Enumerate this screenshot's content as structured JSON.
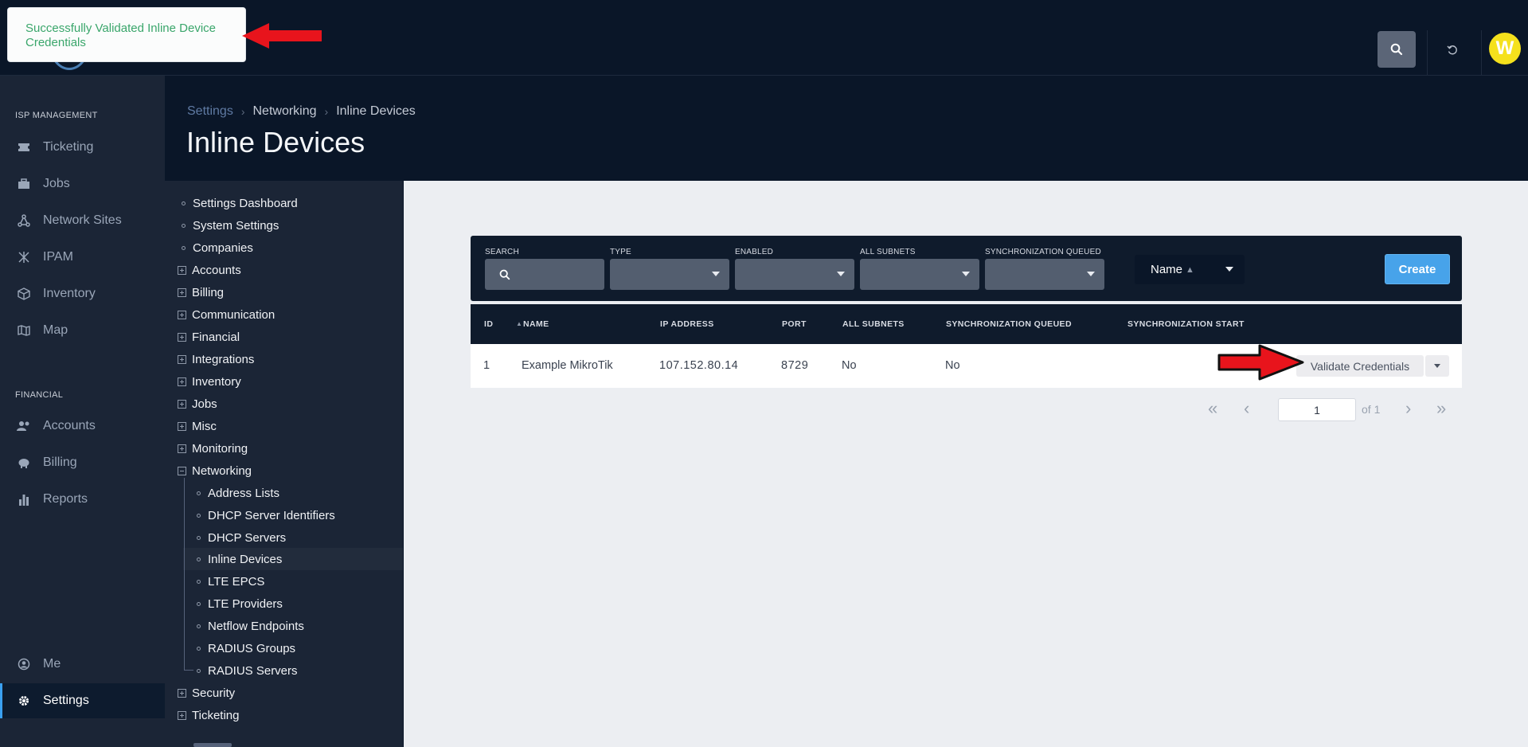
{
  "toast": {
    "message": "Successfully Validated Inline Device Credentials"
  },
  "topbar": {
    "avatar_letter": "W",
    "icons": [
      "search-icon",
      "refresh-icon"
    ]
  },
  "nav": {
    "sections": [
      {
        "label": "ISP MANAGEMENT",
        "items": [
          {
            "label": "Ticketing",
            "icon": "ticket-icon"
          },
          {
            "label": "Jobs",
            "icon": "toolbox-icon"
          },
          {
            "label": "Network Sites",
            "icon": "network-sites-icon"
          },
          {
            "label": "IPAM",
            "icon": "ipam-icon"
          },
          {
            "label": "Inventory",
            "icon": "cube-icon"
          },
          {
            "label": "Map",
            "icon": "map-icon"
          }
        ]
      },
      {
        "label": "FINANCIAL",
        "items": [
          {
            "label": "Accounts",
            "icon": "users-icon"
          },
          {
            "label": "Billing",
            "icon": "piggy-bank-icon"
          },
          {
            "label": "Reports",
            "icon": "bar-chart-icon"
          }
        ]
      }
    ],
    "bottom": [
      {
        "label": "Me",
        "icon": "user-circle-icon"
      },
      {
        "label": "Settings",
        "icon": "gear-icon",
        "active": true
      }
    ]
  },
  "breadcrumb": [
    "Settings",
    "Networking",
    "Inline Devices"
  ],
  "page_title": "Inline Devices",
  "tree": {
    "top": [
      "Settings Dashboard",
      "System Settings",
      "Companies"
    ],
    "groups": [
      "Accounts",
      "Billing",
      "Communication",
      "Financial",
      "Integrations",
      "Inventory",
      "Jobs",
      "Misc",
      "Monitoring"
    ],
    "networking": {
      "label": "Networking",
      "children": [
        "Address Lists",
        "DHCP Server Identifiers",
        "DHCP Servers",
        "Inline Devices",
        "LTE EPCS",
        "LTE Providers",
        "Netflow Endpoints",
        "RADIUS Groups",
        "RADIUS Servers"
      ],
      "active_child": "Inline Devices"
    },
    "after": [
      "Security",
      "Ticketing"
    ]
  },
  "filters": {
    "search_label": "SEARCH",
    "type_label": "TYPE",
    "enabled_label": "ENABLED",
    "all_subnets_label": "ALL SUBNETS",
    "sync_queued_label": "SYNCHRONIZATION QUEUED",
    "sort_label": "Name",
    "create_label": "Create"
  },
  "table": {
    "columns": [
      "ID",
      "NAME",
      "IP ADDRESS",
      "PORT",
      "ALL SUBNETS",
      "SYNCHRONIZATION QUEUED",
      "SYNCHRONIZATION START"
    ],
    "rows": [
      {
        "id": "1",
        "name": "Example MikroTik",
        "ip": "107.152.80.14",
        "port": "8729",
        "all_subnets": "No",
        "sync_queued": "No",
        "action": "Validate Credentials"
      }
    ]
  },
  "pagination": {
    "page": "1",
    "of_label": "of 1"
  },
  "colors": {
    "accent": "#47a3ea",
    "toast_text": "#3aa66b",
    "nav_bg": "#1b2536",
    "header_bg": "#0a1628",
    "avatar": "#f5e11c",
    "annotation_arrow": "#e8141c"
  }
}
